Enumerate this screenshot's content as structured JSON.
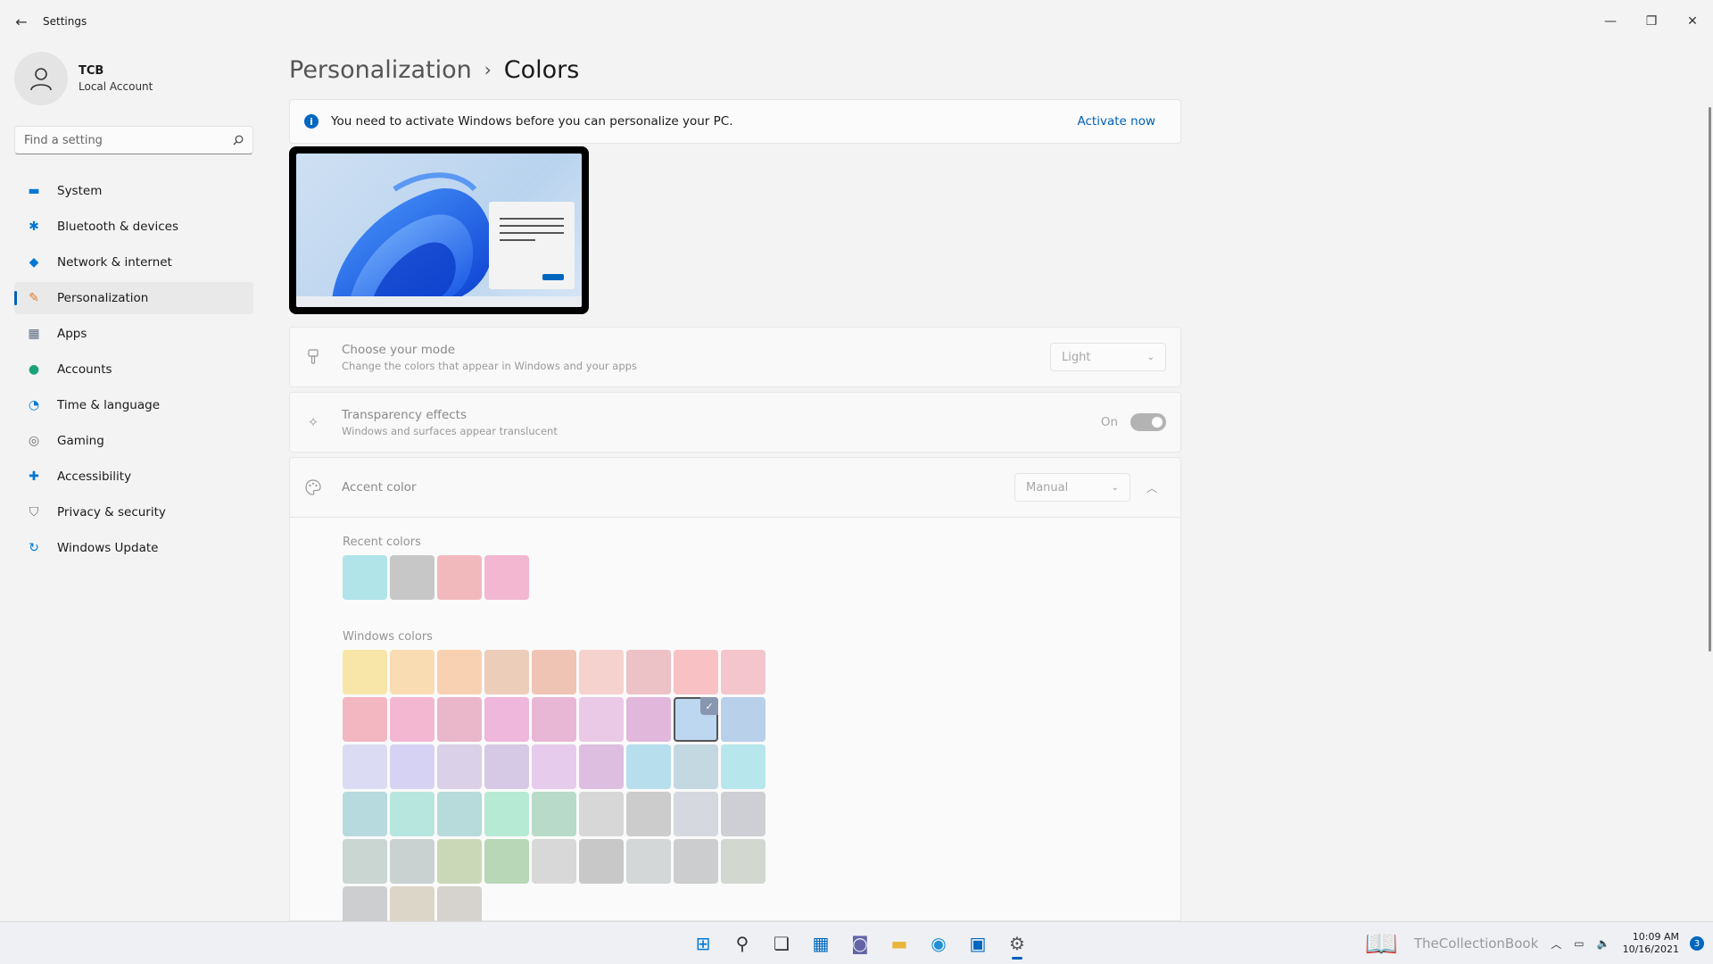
{
  "window": {
    "title": "Settings",
    "back_icon": "←",
    "minimize_icon": "—",
    "maximize_icon": "❐",
    "close_icon": "✕"
  },
  "profile": {
    "name": "TCB",
    "account_type": "Local Account"
  },
  "search": {
    "placeholder": "Find a setting"
  },
  "sidebar": {
    "items": [
      {
        "label": "System",
        "icon": "monitor-icon",
        "color": "#0078d4"
      },
      {
        "label": "Bluetooth & devices",
        "icon": "bluetooth-icon",
        "color": "#0078d4"
      },
      {
        "label": "Network & internet",
        "icon": "wifi-icon",
        "color": "#0078d4"
      },
      {
        "label": "Personalization",
        "icon": "brush-icon",
        "color": "#e07a2f"
      },
      {
        "label": "Apps",
        "icon": "apps-icon",
        "color": "#5b6a80"
      },
      {
        "label": "Accounts",
        "icon": "person-icon",
        "color": "#1aa37a"
      },
      {
        "label": "Time & language",
        "icon": "globe-clock-icon",
        "color": "#0078d4"
      },
      {
        "label": "Gaming",
        "icon": "gamepad-icon",
        "color": "#6b6b6b"
      },
      {
        "label": "Accessibility",
        "icon": "accessibility-icon",
        "color": "#0078d4"
      },
      {
        "label": "Privacy & security",
        "icon": "shield-icon",
        "color": "#6b6b6b"
      },
      {
        "label": "Windows Update",
        "icon": "update-icon",
        "color": "#0078d4"
      }
    ],
    "active_index": 3
  },
  "breadcrumb": {
    "parent": "Personalization",
    "separator": "›",
    "current": "Colors"
  },
  "banner": {
    "text": "You need to activate Windows before you can personalize your PC.",
    "link": "Activate now"
  },
  "mode": {
    "title": "Choose your mode",
    "subtitle": "Change the colors that appear in Windows and your apps",
    "value": "Light"
  },
  "transparency": {
    "title": "Transparency effects",
    "subtitle": "Windows and surfaces appear translucent",
    "state": "On"
  },
  "accent": {
    "title": "Accent color",
    "value": "Manual",
    "recent_label": "Recent colors",
    "recent_colors": [
      "#a9e3e8",
      "#c3c3c3",
      "#f2b3b8",
      "#f3b1cf"
    ],
    "windows_label": "Windows colors",
    "windows_colors": [
      [
        "#f9e5a1",
        "#fadaaa",
        "#f9cdab",
        "#ecc9b4",
        "#f0bfae",
        "#f6cfcb",
        "#ecbdc2",
        "#f9bcc0",
        "#f5c1c8"
      ],
      [
        "#f3b1bc",
        "#f3b1cf",
        "#e8b1c5",
        "#efb1d9",
        "#e9b1d3",
        "#eac5e6",
        "#e0b1da",
        "#b8d5f0",
        "#b2cdea"
      ],
      [
        "#d9d9f3",
        "#d2cff3",
        "#d8cde6",
        "#d3c5e5",
        "#e6c7ec",
        "#dbb8de",
        "#b1dced",
        "#bfd6e1",
        "#b1e6ec"
      ],
      [
        "#b1d8dc",
        "#b1e5dc",
        "#b1d8d8",
        "#b1ead2",
        "#b1d9c4",
        "#d4d4d4",
        "#c8c8c8",
        "#d2d6dc",
        "#c9ccd1"
      ],
      [
        "#c5d3cf",
        "#c5cfcd",
        "#c7d6b1",
        "#b1d4b1",
        "#d6d6d6",
        "#c4c4c4",
        "#d0d4d6",
        "#c7c9cb",
        "#cfd4cd"
      ],
      [
        "#c9cbcc",
        "#d9d3c4",
        "#d3d0cb"
      ]
    ],
    "selected": [
      1,
      7
    ]
  },
  "taskbar": {
    "icons": [
      {
        "name": "start-icon",
        "glyph": "⊞",
        "color": "#0078d4"
      },
      {
        "name": "search-icon",
        "glyph": "⚲",
        "color": "#333333"
      },
      {
        "name": "task-view-icon",
        "glyph": "❏",
        "color": "#333333"
      },
      {
        "name": "widgets-icon",
        "glyph": "▦",
        "color": "#0067c0"
      },
      {
        "name": "chat-icon",
        "glyph": "◙",
        "color": "#6264a7"
      },
      {
        "name": "file-explorer-icon",
        "glyph": "▬",
        "color": "#e8b53a"
      },
      {
        "name": "edge-icon",
        "glyph": "◉",
        "color": "#1f8fd6"
      },
      {
        "name": "store-icon",
        "glyph": "▣",
        "color": "#0067c0"
      },
      {
        "name": "settings-icon",
        "glyph": "⚙",
        "color": "#555555"
      }
    ],
    "active_index": 8,
    "watermark": "TheCollectionBook",
    "time": "10:09 AM",
    "date": "10/16/2021",
    "notifications": "3"
  }
}
